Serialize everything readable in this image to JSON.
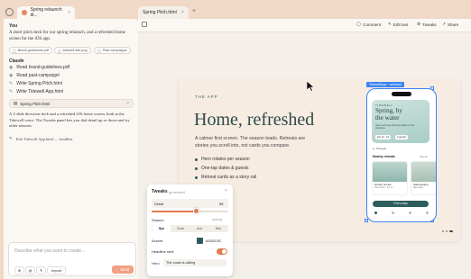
{
  "tabs": [
    {
      "label": "Spring relaunch di..."
    },
    {
      "label": "Spring Pitch.html"
    }
  ],
  "chat": {
    "you_label": "You",
    "user_message": "A short pitch deck for our spring relaunch, and a refreshed home screen for the iOS app.",
    "attachments": [
      "Brand guidelines.pdf",
      "tidewell site.png",
      "Past campaigns"
    ],
    "claude_label": "Claude",
    "actions": [
      "Read brand-guidelines.pdf",
      "Read past-campaign/",
      "Write Spring Pitch.html",
      "Write Tidewell App.html"
    ],
    "file_card": "Spring Pitch.html",
    "reply": "A 3-slide direction deck and a refreshed iOS home screen, both in the Tidewell voice. The Tweaks panel lets you dial detail up or down and try other seasons.",
    "edit_line": "Edit Tidewell App.html — headline",
    "input_placeholder": "Describe what you want to create...",
    "import_label": "Import",
    "send_label": "Send"
  },
  "toolbar": {
    "comment": "Comment",
    "edit_text": "Edit text",
    "tweaks": "Tweaks",
    "share": "Share"
  },
  "slide": {
    "eyebrow": "THE APP",
    "title": "Home, refreshed",
    "body": "A calmer first screen. The season leads. Retreats are stories you scroll into, not cards you compare.",
    "bullets": [
      "Hero rotates per season",
      "One-tap dates & guests",
      "Retreat cards as a story rail"
    ]
  },
  "tweaks": {
    "title": "Tweaks",
    "subtitle": "generated",
    "detail_label": "Detail",
    "detail_value": "58",
    "detail_fraction": 0.58,
    "season_label": "Season",
    "season_hint": "cycling",
    "seasons": [
      "Spr",
      "Sum",
      "Aut",
      "Win"
    ],
    "season_selected": "Spr",
    "accent_label": "Accent",
    "accent_value": "#2D5C5C",
    "accent_color": "#2d5c5c",
    "headline_label": "Headline serif",
    "headline_on": true,
    "hero_label": "Hero",
    "hero_value": "The coast is calling"
  },
  "phone": {
    "badge": "TidewellApp · artboard",
    "brand": "TIDEWELL",
    "hero_title": "Spring, by the water",
    "hero_sub": "Slow mornings and long walks on the shoreline.",
    "dates": "Apr 12 - 14",
    "guests": "2 guests",
    "location": "Tidewell",
    "section": "Nearby retreats",
    "see_all": "See all",
    "card1_title": "Harbor House",
    "card1_meta": "Cove Point · 3.4 mi",
    "card2_title": "Saltmeadow",
    "card2_meta": "Bay Road",
    "cta": "Find a stay"
  },
  "colors": {
    "accent": "#e07a4f",
    "teal": "#2d5c5c",
    "send": "#f0a083"
  }
}
